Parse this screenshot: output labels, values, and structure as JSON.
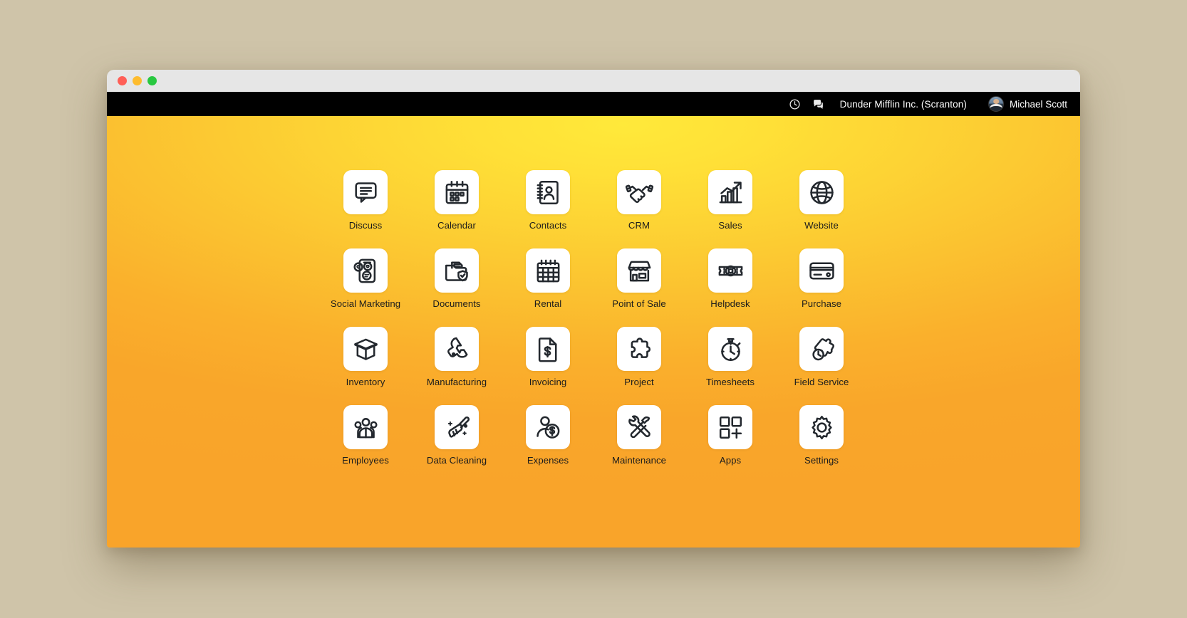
{
  "window": {
    "traffic_lights": [
      "close",
      "minimize",
      "maximize"
    ],
    "colors": {
      "close": "#ff5f57",
      "minimize": "#febc2e",
      "maximize": "#28c840",
      "desktop": "#cfc4a9",
      "navbar": "#000000",
      "gradient_center": "#ffe93a",
      "gradient_edge": "#f9a42a"
    }
  },
  "navbar": {
    "icons": [
      {
        "name": "clock-icon",
        "glyph": "clock"
      },
      {
        "name": "messages-icon",
        "glyph": "chat-bubble"
      }
    ],
    "company": "Dunder Mifflin Inc. (Scranton)",
    "user": "Michael Scott"
  },
  "apps": [
    {
      "label": "Discuss",
      "icon": "discuss-icon"
    },
    {
      "label": "Calendar",
      "icon": "calendar-icon"
    },
    {
      "label": "Contacts",
      "icon": "contacts-icon"
    },
    {
      "label": "CRM",
      "icon": "handshake-icon"
    },
    {
      "label": "Sales",
      "icon": "growth-chart-icon"
    },
    {
      "label": "Website",
      "icon": "globe-icon"
    },
    {
      "label": "Social Marketing",
      "icon": "social-phone-icon"
    },
    {
      "label": "Documents",
      "icon": "documents-shield-icon"
    },
    {
      "label": "Rental",
      "icon": "rental-calendar-icon"
    },
    {
      "label": "Point of Sale",
      "icon": "storefront-icon"
    },
    {
      "label": "Helpdesk",
      "icon": "life-ring-ticket-icon"
    },
    {
      "label": "Purchase",
      "icon": "credit-card-icon"
    },
    {
      "label": "Inventory",
      "icon": "open-box-icon"
    },
    {
      "label": "Manufacturing",
      "icon": "wrench-icon"
    },
    {
      "label": "Invoicing",
      "icon": "dollar-document-icon"
    },
    {
      "label": "Project",
      "icon": "puzzle-piece-icon"
    },
    {
      "label": "Timesheets",
      "icon": "stopwatch-icon"
    },
    {
      "label": "Field Service",
      "icon": "puzzle-clock-icon"
    },
    {
      "label": "Employees",
      "icon": "people-group-icon"
    },
    {
      "label": "Data Cleaning",
      "icon": "broom-sparkle-icon"
    },
    {
      "label": "Expenses",
      "icon": "person-coin-icon"
    },
    {
      "label": "Maintenance",
      "icon": "wrench-hammer-icon"
    },
    {
      "label": "Apps",
      "icon": "apps-grid-plus-icon"
    },
    {
      "label": "Settings",
      "icon": "gear-icon"
    }
  ]
}
